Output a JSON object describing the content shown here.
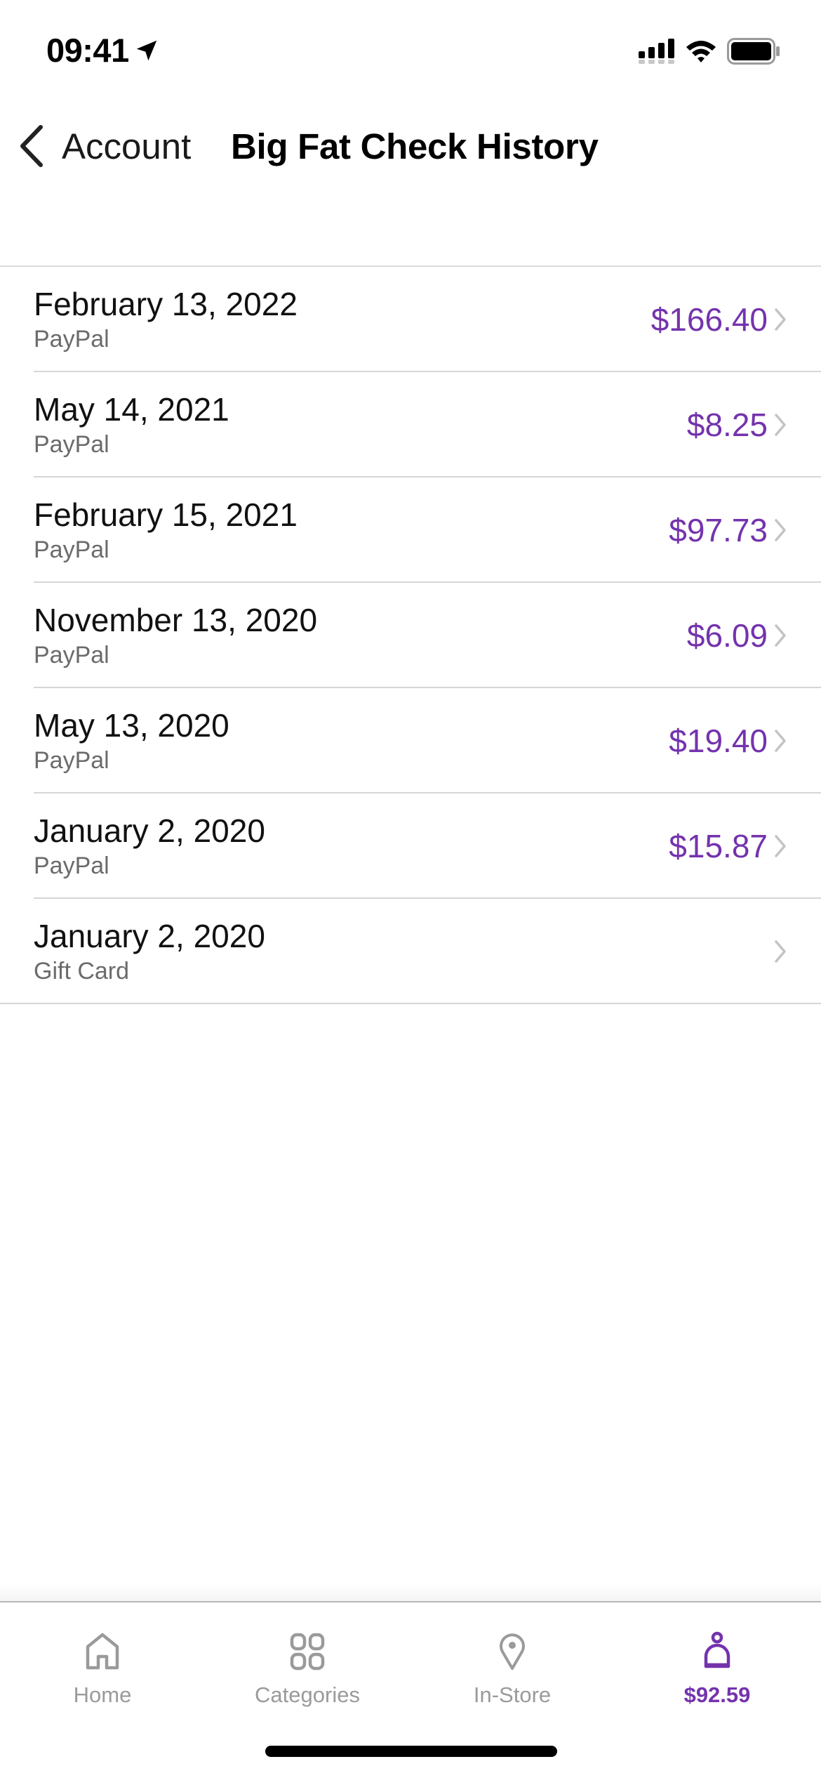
{
  "status_bar": {
    "time": "09:41",
    "icons": [
      "location-arrow-icon",
      "cellular-signal-icon",
      "wifi-icon",
      "battery-icon"
    ]
  },
  "nav": {
    "back_label": "Account",
    "back_icon": "chevron-left-icon",
    "title": "Big Fat Check History"
  },
  "history": {
    "rows": [
      {
        "date": "February 13, 2022",
        "method": "PayPal",
        "amount": "$166.40"
      },
      {
        "date": "May 14, 2021",
        "method": "PayPal",
        "amount": "$8.25"
      },
      {
        "date": "February 15, 2021",
        "method": "PayPal",
        "amount": "$97.73"
      },
      {
        "date": "November 13, 2020",
        "method": "PayPal",
        "amount": "$6.09"
      },
      {
        "date": "May 13, 2020",
        "method": "PayPal",
        "amount": "$19.40"
      },
      {
        "date": "January 2, 2020",
        "method": "PayPal",
        "amount": "$15.87"
      },
      {
        "date": "January 2, 2020",
        "method": "Gift Card",
        "amount": ""
      }
    ]
  },
  "tab_bar": {
    "tabs": [
      {
        "label": "Home",
        "icon": "home-icon",
        "active": false
      },
      {
        "label": "Categories",
        "icon": "grid-icon",
        "active": false
      },
      {
        "label": "In-Store",
        "icon": "map-pin-icon",
        "active": false
      },
      {
        "label": "$92.59",
        "icon": "person-icon",
        "active": true
      }
    ]
  },
  "colors": {
    "accent": "#7433ad",
    "inactive": "#9a9a9a",
    "separator": "#d6d6d6"
  }
}
